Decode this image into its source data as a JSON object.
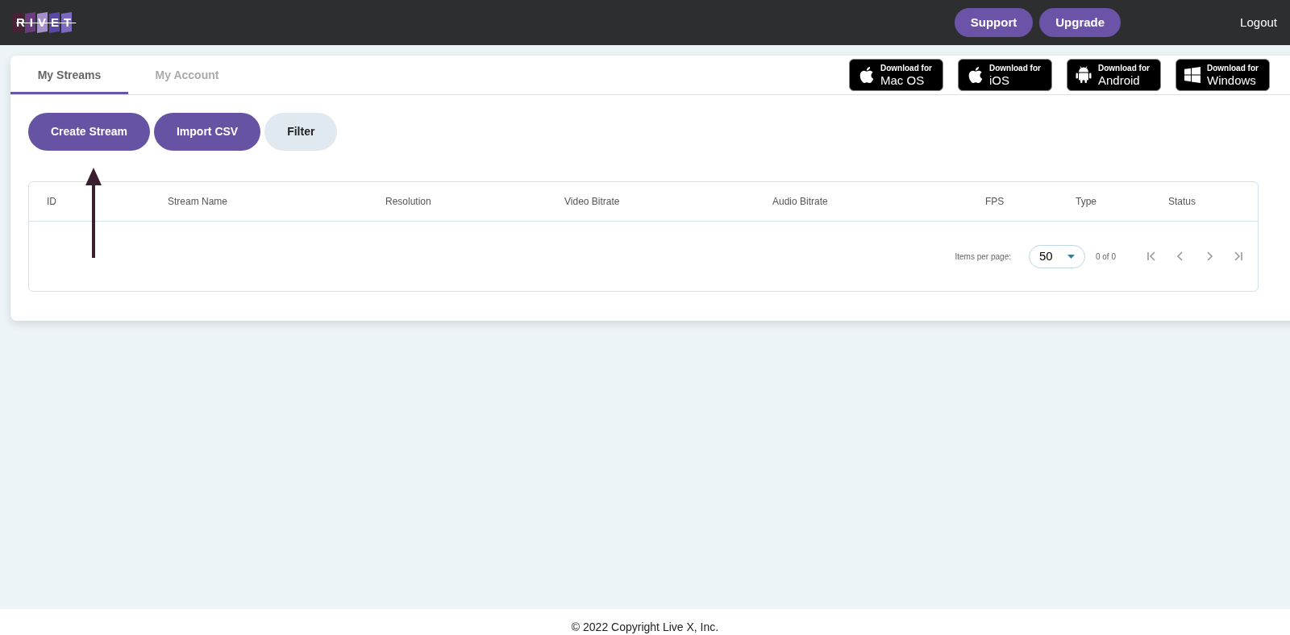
{
  "header": {
    "logo": "RIVET",
    "buttons": [
      "Support",
      "Upgrade"
    ],
    "logout": "Logout"
  },
  "tabs": [
    {
      "label": "My Streams",
      "selected": true
    },
    {
      "label": "My Account",
      "selected": false
    }
  ],
  "downloads": [
    {
      "kind": "apple",
      "caption": "Download for",
      "platform": "Mac OS"
    },
    {
      "kind": "apple",
      "caption": "Download for",
      "platform": "iOS"
    },
    {
      "kind": "android",
      "caption": "Download for",
      "platform": "Android"
    },
    {
      "kind": "windows",
      "caption": "Download for",
      "platform": "Windows"
    }
  ],
  "actions": [
    {
      "label": "Create Stream",
      "kind": "primary"
    },
    {
      "label": "Import CSV",
      "kind": "primary"
    },
    {
      "label": "Filter",
      "kind": "secondary"
    }
  ],
  "table": {
    "columns": [
      "ID",
      "Stream Name",
      "Resolution",
      "Video Bitrate",
      "Audio Bitrate",
      "FPS",
      "Type",
      "Status"
    ]
  },
  "pagination": {
    "items_label": "Items per page:",
    "page_size": "50",
    "range": "0 of 0"
  },
  "footer": "© 2022 Copyright Live X, Inc."
}
